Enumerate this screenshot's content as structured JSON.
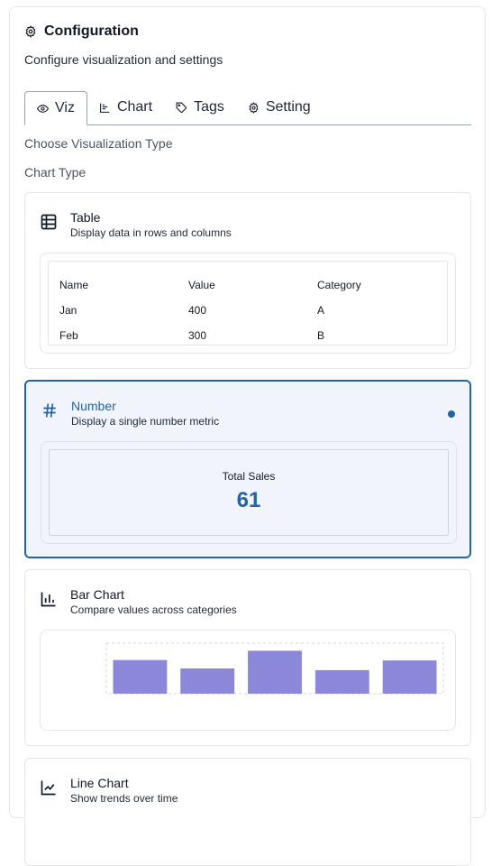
{
  "header": {
    "title": "Configuration",
    "subtitle": "Configure visualization and settings"
  },
  "tabs": [
    {
      "label": "Viz",
      "icon": "eye-icon",
      "active": true
    },
    {
      "label": "Chart",
      "icon": "chart-icon",
      "active": false
    },
    {
      "label": "Tags",
      "icon": "tag-icon",
      "active": false
    },
    {
      "label": "Setting",
      "icon": "gear-icon",
      "active": false
    }
  ],
  "section_label": "Choose Visualization Type",
  "chart_type_label": "Chart Type",
  "cards": {
    "table": {
      "title": "Table",
      "description": "Display data in rows and columns",
      "columns": [
        "Name",
        "Value",
        "Category"
      ],
      "rows": [
        [
          "Jan",
          "400",
          "A"
        ],
        [
          "Feb",
          "300",
          "B"
        ]
      ]
    },
    "number": {
      "title": "Number",
      "description": "Display a single number metric",
      "metric_label": "Total Sales",
      "metric_value": "61",
      "selected": true
    },
    "bar": {
      "title": "Bar Chart",
      "description": "Compare values across categories"
    },
    "line": {
      "title": "Line Chart",
      "description": "Show trends over time"
    }
  },
  "colors": {
    "accent": "#2563a8",
    "bar": "#8b87d9"
  },
  "chart_data": {
    "type": "bar",
    "values": [
      400,
      300,
      510,
      280,
      395
    ],
    "ylim": [
      0,
      600
    ]
  }
}
